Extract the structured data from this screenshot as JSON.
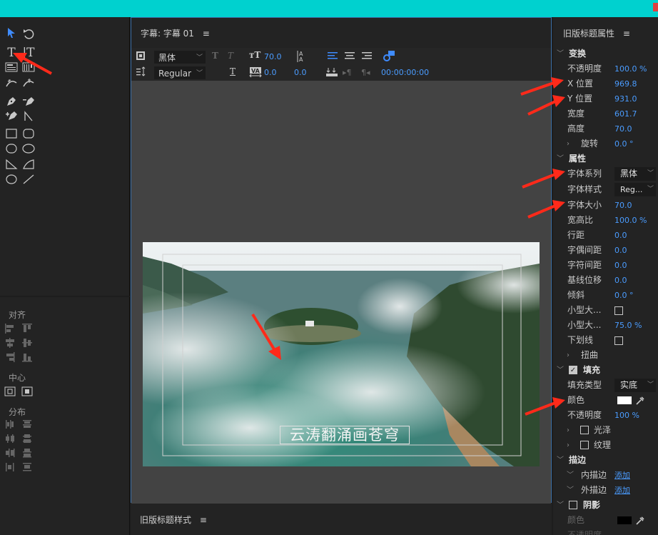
{
  "tools_panel": {
    "align_label": "对齐",
    "center_label": "中心",
    "distribute_label": "分布"
  },
  "center_panel": {
    "title": "字幕: 字幕 01",
    "menu_icon": "≡",
    "font_family": "黑体",
    "font_style": "Regular",
    "font_size": "70.0",
    "kerning": "0.0",
    "leading": "0.0",
    "timecode": "00:00:00:00",
    "caption_text": "云涛翻涌画苍穹"
  },
  "bottom_panel": {
    "title": "旧版标题样式",
    "menu_icon": "≡"
  },
  "right_panel": {
    "title": "旧版标题属性",
    "menu_icon": "≡",
    "transform": {
      "section": "变换",
      "opacity_label": "不透明度",
      "opacity_value": "100.0 %",
      "x_label": "X 位置",
      "x_value": "969.8",
      "y_label": "Y 位置",
      "y_value": "931.0",
      "width_label": "宽度",
      "width_value": "601.7",
      "height_label": "高度",
      "height_value": "70.0",
      "rotation_label": "旋转",
      "rotation_value": "0.0 °"
    },
    "properties": {
      "section": "属性",
      "font_family_label": "字体系列",
      "font_family_value": "黑体",
      "font_style_label": "字体样式",
      "font_style_value": "Reg...",
      "font_size_label": "字体大小",
      "font_size_value": "70.0",
      "aspect_label": "宽高比",
      "aspect_value": "100.0 %",
      "leading_label": "行距",
      "leading_value": "0.0",
      "kerning_label": "字偶间距",
      "kerning_value": "0.0",
      "tracking_label": "字符间距",
      "tracking_value": "0.0",
      "baseline_label": "基线位移",
      "baseline_value": "0.0",
      "slant_label": "倾斜",
      "slant_value": "0.0 °",
      "smallcaps_label": "小型大...",
      "smallcaps_size_label": "小型大...",
      "smallcaps_size_value": "75.0 %",
      "underline_label": "下划线",
      "distort_label": "扭曲"
    },
    "fill": {
      "section": "填充",
      "fill_type_label": "填充类型",
      "fill_type_value": "实底",
      "color_label": "颜色",
      "opacity_label": "不透明度",
      "opacity_value": "100 %",
      "sheen_label": "光泽",
      "texture_label": "纹理"
    },
    "stroke": {
      "section": "描边",
      "inner_label": "内描边",
      "inner_add": "添加",
      "outer_label": "外描边",
      "outer_add": "添加"
    },
    "shadow": {
      "section": "阴影",
      "color_label": "颜色",
      "opacity_label": "不透明度"
    }
  },
  "colors": {
    "accent": "#00d1cf",
    "value_blue": "#4a9cff",
    "annotation_red": "#ff2a1a"
  }
}
